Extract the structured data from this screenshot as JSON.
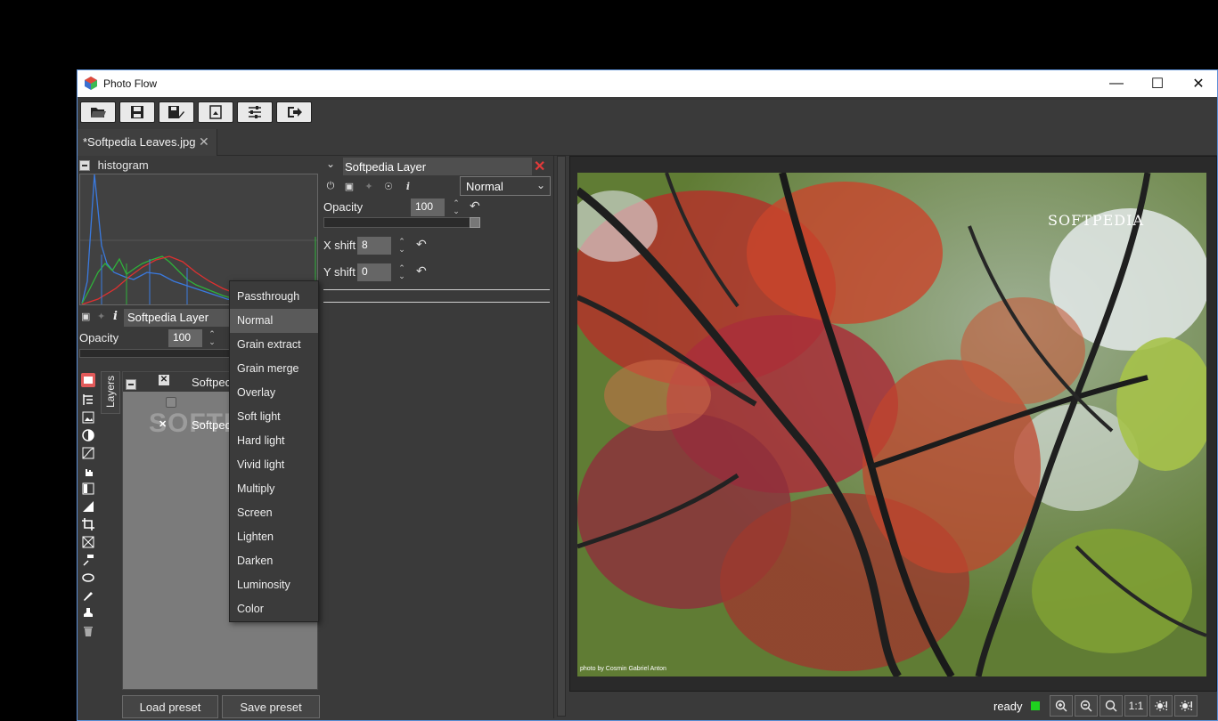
{
  "window": {
    "title": "Photo Flow"
  },
  "tab": {
    "label": "*Softpedia Leaves.jpg"
  },
  "histogram": {
    "title": "histogram"
  },
  "left_layer": {
    "name": "Softpedia Layer",
    "opacity_label": "Opacity",
    "opacity_value": "100"
  },
  "layers_panel": {
    "tab_label": "Layers",
    "header_name": "Softpec",
    "row_name": "Softpec"
  },
  "presets": {
    "load": "Load preset",
    "save": "Save preset"
  },
  "blend_menu": {
    "items": [
      "Passthrough",
      "Normal",
      "Grain extract",
      "Grain merge",
      "Overlay",
      "Soft light",
      "Hard light",
      "Vivid light",
      "Multiply",
      "Screen",
      "Lighten",
      "Darken",
      "Luminosity",
      "Color"
    ],
    "selected": "Normal"
  },
  "editor": {
    "title": "Softpedia Layer",
    "blend_mode": "Normal",
    "opacity_label": "Opacity",
    "opacity_value": "100",
    "opacity_fraction": 1.0,
    "x_shift_label": "X shift",
    "x_shift_value": "8",
    "y_shift_label": "Y shift",
    "y_shift_value": "0"
  },
  "photo": {
    "logo": "SOFTPEDIA",
    "credit": "photo by Cosmin Gabriel Anton"
  },
  "watermark": "SOFTPEDIA",
  "status": {
    "text": "ready",
    "led_color": "#1fd11f",
    "zoom_one": "1:1"
  },
  "icons": [
    "app-icon",
    "open-icon",
    "save-icon",
    "save-as-icon",
    "export-icon",
    "settings-icon",
    "exit-icon",
    "zoom-in-icon",
    "zoom-out-icon",
    "zoom-fit-icon",
    "brightness-icon"
  ]
}
